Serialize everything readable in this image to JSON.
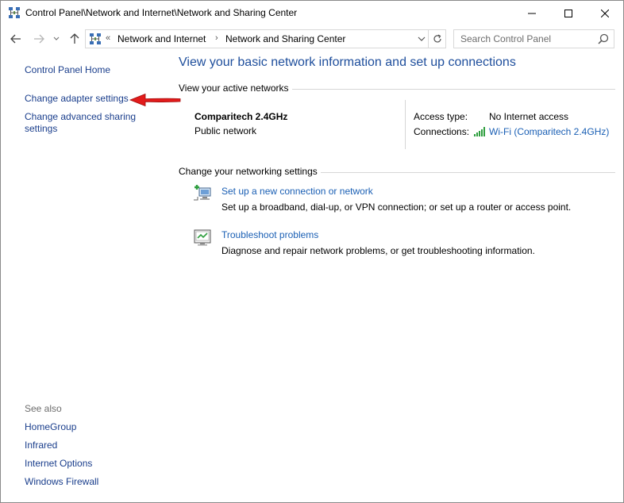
{
  "window": {
    "title": "Control Panel\\Network and Internet\\Network and Sharing Center"
  },
  "address": {
    "overflow": "«",
    "crumbs": [
      "Network and Internet",
      "Network and Sharing Center"
    ],
    "separator": "›"
  },
  "search": {
    "placeholder": "Search Control Panel"
  },
  "sidebar": {
    "links": [
      "Control Panel Home",
      "Change adapter settings",
      "Change advanced sharing settings"
    ],
    "see_also_label": "See also",
    "see_also": [
      "HomeGroup",
      "Infrared",
      "Internet Options",
      "Windows Firewall"
    ]
  },
  "main": {
    "heading": "View your basic network information and set up connections",
    "active_networks_title": "View your active networks",
    "network": {
      "name": "Comparitech 2.4GHz",
      "category": "Public network",
      "access_type_label": "Access type:",
      "access_type_value": "No Internet access",
      "connections_label": "Connections:",
      "connections_value": "Wi-Fi (Comparitech 2.4GHz)"
    },
    "change_settings_title": "Change your networking settings",
    "tasks": [
      {
        "link": "Set up a new connection or network",
        "desc": "Set up a broadband, dial-up, or VPN connection; or set up a router or access point."
      },
      {
        "link": "Troubleshoot problems",
        "desc": "Diagnose and repair network problems, or get troubleshooting information."
      }
    ]
  },
  "colors": {
    "link": "#1a5fb4",
    "heading": "#1e4e9c",
    "annotation_arrow": "#e21b1b"
  },
  "icons": [
    "network-sharing-icon",
    "minimize-icon",
    "maximize-icon",
    "close-icon",
    "back-arrow-icon",
    "forward-arrow-icon",
    "recent-dropdown-icon",
    "up-arrow-icon",
    "refresh-icon",
    "search-icon",
    "wifi-signal-icon",
    "new-connection-icon",
    "troubleshoot-icon"
  ]
}
